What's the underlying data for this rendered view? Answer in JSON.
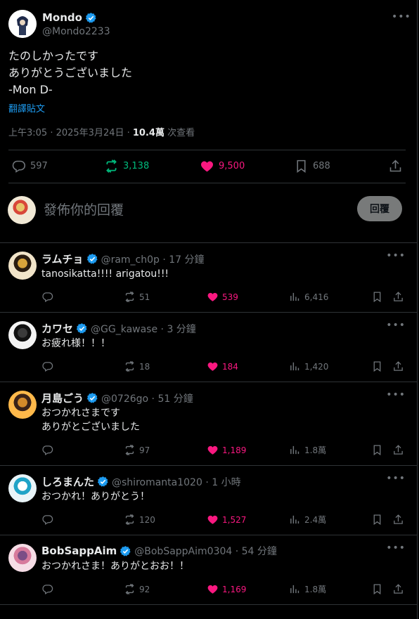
{
  "main": {
    "name": "Mondo",
    "handle": "@Mondo2233",
    "text": "たのしかったです\nありがとうございました\n-Mon D-",
    "translate": "翻譯貼文",
    "time": "上午3:05 · 2025年3月24日 · ",
    "views_count": "10.4萬",
    "views_label": " 次查看",
    "replies": "597",
    "reposts": "3,138",
    "likes": "9,500",
    "bookmarks": "688"
  },
  "composer": {
    "placeholder": "發佈你的回覆",
    "button": "回覆"
  },
  "replies": [
    {
      "name": "ラムチョ",
      "handle": "@ram_ch0p · 17 分鐘",
      "text": "tanosikatta!!!! arigatou!!!",
      "replies": "",
      "reposts": "51",
      "likes": "539",
      "views": "6,416"
    },
    {
      "name": "カワセ",
      "handle": "@GG_kawase · 3 分鐘",
      "text": "お疲れ様！！！",
      "replies": "",
      "reposts": "18",
      "likes": "184",
      "views": "1,420"
    },
    {
      "name": "月島ごう",
      "handle": "@0726go · 51 分鐘",
      "text": "おつかれさまです\nありがとございました",
      "replies": "",
      "reposts": "97",
      "likes": "1,189",
      "views": "1.8萬"
    },
    {
      "name": "しろまんた",
      "handle": "@shiromanta1020 · 1 小時",
      "text": "おつかれ！ありがとう！",
      "replies": "",
      "reposts": "120",
      "likes": "1,527",
      "views": "2.4萬"
    },
    {
      "name": "BobSappAim",
      "handle": "@BobSappAim0304 · 54 分鐘",
      "text": "おつかれさま！ありがとおお！！",
      "replies": "",
      "reposts": "92",
      "likes": "1,169",
      "views": "1.8萬"
    }
  ],
  "colors": {
    "background": "#000000",
    "text": "#e7e9ea",
    "muted": "#71767b",
    "link": "#1d9bf0",
    "like": "#f91880",
    "repost": "#00ba7c",
    "verified": "#1d9bf0"
  }
}
